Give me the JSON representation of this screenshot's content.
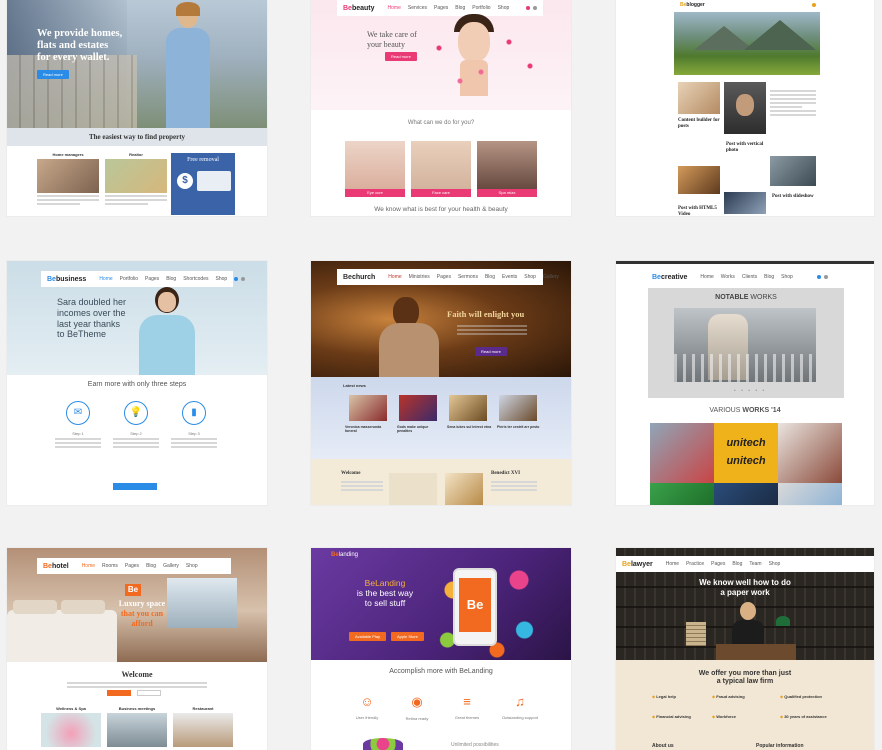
{
  "grid": [
    {
      "theme": "realestate",
      "headline": [
        "We provide homes,",
        "flats and estates",
        "for every wallet."
      ],
      "button": "Read more",
      "section_title": "The easiest way to find property",
      "columns": [
        "Home managers",
        "Realtor",
        "Free removal"
      ]
    },
    {
      "theme": "beauty",
      "logo_prefix": "Be",
      "logo_name": "beauty",
      "menu": [
        "Home",
        "Services",
        "Pages",
        "Blog",
        "Portfolio",
        "Shop"
      ],
      "headline": [
        "We take care of",
        "your beauty"
      ],
      "button": "Read more",
      "section_title": "What can we do for you?",
      "tiles": [
        "Eye cure",
        "Face care",
        "Spa relax"
      ],
      "footer_text": "We know what is best for your health & beauty"
    },
    {
      "theme": "blogger",
      "logo_prefix": "Be",
      "logo_name": "blogger",
      "posts": [
        "Content builder for posts",
        "Post with vertical photo",
        "Post with HTML5 Video",
        "Post with slideshow"
      ]
    },
    {
      "theme": "business",
      "logo_prefix": "Be",
      "logo_name": "business",
      "menu": [
        "Home",
        "Portfolio",
        "Pages",
        "Blog",
        "Shortcodes",
        "Shop"
      ],
      "headline": [
        "Sara doubled her",
        "incomes over the",
        "last year thanks",
        "to BeTheme"
      ],
      "section_title": "Earn more with only three steps",
      "steps": [
        "Step 1",
        "Step 2",
        "Step 3"
      ]
    },
    {
      "theme": "church",
      "logo_prefix": "Be",
      "logo_name": "church",
      "menu": [
        "Home",
        "Ministries",
        "Pages",
        "Sermons",
        "Blog",
        "Events",
        "Shop",
        "Gallery"
      ],
      "headline": "Faith will enlight you",
      "button": "Read more",
      "news_title": "Latest news",
      "news": [
        "Veronica masserunda funeral",
        "Gods make unique penalties",
        "Sena lukes sul intrect etna",
        "Pieris ter cestrit arr pesto"
      ],
      "welcome": "Welcome",
      "benedict": "Benedict XVI"
    },
    {
      "theme": "creative",
      "logo_prefix": "Be",
      "logo_name": "creative",
      "menu": [
        "Home",
        "Works",
        "Clients",
        "Blog",
        "Shop"
      ],
      "notable": "NOTABLE",
      "works": "WORKS",
      "various": "VARIOUS",
      "works14": "WORKS '14",
      "unitech": "unitech"
    },
    {
      "theme": "hotel",
      "logo_prefix": "Be",
      "logo_name": "hotel",
      "menu": [
        "Home",
        "Rooms",
        "Pages",
        "Blog",
        "Gallery",
        "Shop"
      ],
      "badge": "Be",
      "headline": [
        "Luxury space",
        "that you can",
        "afford"
      ],
      "welcome": "Welcome",
      "features": [
        "Wellness & Spa",
        "Business meetings",
        "Restaurant"
      ]
    },
    {
      "theme": "landing",
      "logo_prefix": "Be",
      "logo_name": "landing",
      "headline": [
        "BeLanding",
        "is the best way",
        "to sell stuff"
      ],
      "phone_logo": "Be",
      "buttons": [
        "Available Play",
        "Apple Store"
      ],
      "section_title": "Accomplish more with BeLanding",
      "features": [
        "User friendly",
        "Retina ready",
        "Great themes",
        "Outstanding support"
      ],
      "bottom": "Unlimited possibilities"
    },
    {
      "theme": "lawyer",
      "logo_prefix": "Be",
      "logo_name": "lawyer",
      "menu": [
        "Home",
        "Practice",
        "Pages",
        "Blog",
        "Team",
        "Shop"
      ],
      "headline": [
        "We know well how to do",
        "a paper work"
      ],
      "offer": [
        "We offer you more than just",
        "a typical law firm"
      ],
      "features": [
        "Legal help",
        "Financial advising",
        "Fraud advising",
        "Workforce",
        "Qualified protection",
        "30 years of assistance"
      ],
      "footer_left": "About us",
      "footer_right": "Popular information"
    }
  ],
  "colors": {
    "blue": "#2a8ce6",
    "pink": "#ea3a76",
    "orange": "#f26a1f",
    "gold": "#e8a21b",
    "purple": "#5b2b8c"
  }
}
